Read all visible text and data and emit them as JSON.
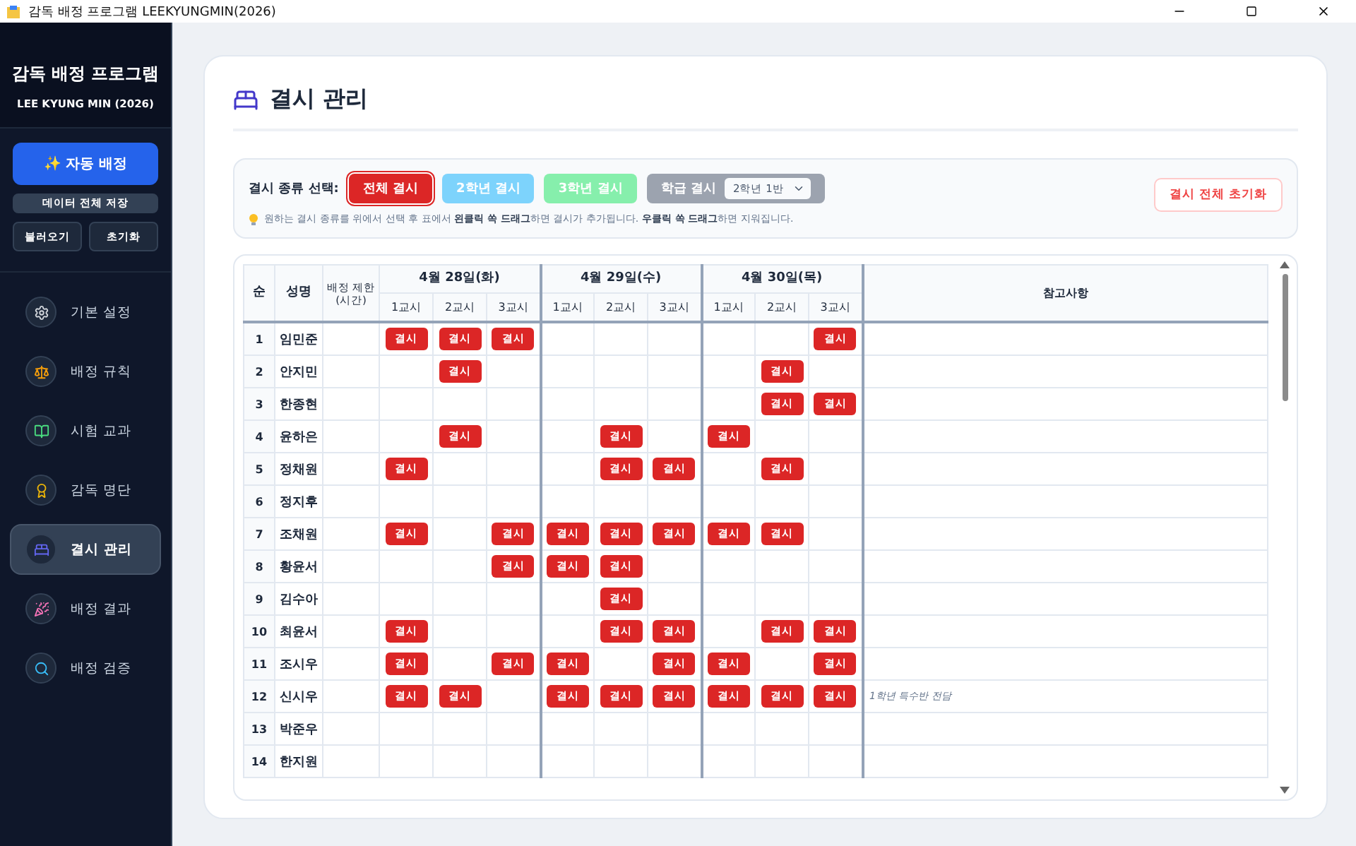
{
  "window": {
    "title": "감독 배정 프로그램 LEEKYUNGMIN(2026)"
  },
  "sidebar": {
    "title": "감독 배정 프로그램",
    "subtitle": "LEE KYUNG MIN (2026)",
    "primary_button": "✨ 자동 배정",
    "save_button": "데이터 전체 저장",
    "small_buttons": [
      "불러오기",
      "초기화"
    ],
    "items": [
      {
        "label": "기본 설정",
        "kind": "gear",
        "selected": false
      },
      {
        "label": "배정 규칙",
        "kind": "scale",
        "selected": false
      },
      {
        "label": "시험 교과",
        "kind": "books",
        "selected": false
      },
      {
        "label": "감독 명단",
        "kind": "medal",
        "selected": false
      },
      {
        "label": "결시 관리",
        "kind": "bed",
        "selected": true
      },
      {
        "label": "배정 결과",
        "kind": "party",
        "selected": false
      },
      {
        "label": "배정 검증",
        "kind": "search",
        "selected": false
      }
    ]
  },
  "page": {
    "title": "결시 관리"
  },
  "filter": {
    "label": "결시 종류 선택:",
    "types": [
      {
        "label": "전체 결시",
        "color": "#dc2626",
        "selected": true
      },
      {
        "label": "2학년 결시",
        "color": "#7dd3fc",
        "selected": false
      },
      {
        "label": "3학년 결시",
        "color": "#86efac",
        "selected": false
      },
      {
        "label": "학급 결시",
        "color": "#9ca3af",
        "selected": false,
        "select_value": "2학년 1반"
      }
    ],
    "hint": "원하는 결시 종류를 위에서 선택 후 표에서 **왼클릭 쏙 드래그**하면 결시가 추가됩니다. **우클릭 쏙 드래그**하면 지워집니다.",
    "reset_button": "결시 전체 초기화"
  },
  "table": {
    "columns": [
      "순",
      "성명",
      "배정 제한\n(시간)"
    ],
    "days": [
      {
        "label": "4월 28일(화)",
        "periods": [
          "1교시",
          "2교시",
          "3교시"
        ]
      },
      {
        "label": "4월 29일(수)",
        "periods": [
          "1교시",
          "2교시",
          "3교시"
        ]
      },
      {
        "label": "4월 30일(목)",
        "periods": [
          "1교시",
          "2교시",
          "3교시"
        ]
      }
    ],
    "notes_column": "참고사항",
    "rows": [
      {
        "no": "1",
        "name": "임민준",
        "slots": [
          {
            "absent": true,
            "label": "결시"
          },
          {
            "absent": true,
            "label": "결시"
          },
          {
            "absent": true,
            "label": "결시"
          },
          {
            "absent": false
          },
          {
            "absent": false
          },
          {
            "absent": false
          },
          {
            "absent": false
          },
          {
            "absent": false
          },
          {
            "absent": true,
            "label": "결시"
          }
        ]
      },
      {
        "no": "2",
        "name": "안지민",
        "slots": [
          {
            "absent": false
          },
          {
            "absent": true,
            "label": "결시"
          },
          {
            "absent": false
          },
          {
            "absent": false
          },
          {
            "absent": false
          },
          {
            "absent": false
          },
          {
            "absent": false
          },
          {
            "absent": true,
            "label": "결시"
          },
          {
            "absent": false
          }
        ]
      },
      {
        "no": "3",
        "name": "한종현",
        "slots": [
          {
            "absent": false
          },
          {
            "absent": false
          },
          {
            "absent": false
          },
          {
            "absent": false
          },
          {
            "absent": false
          },
          {
            "absent": false
          },
          {
            "absent": false
          },
          {
            "absent": true,
            "label": "결시"
          },
          {
            "absent": true,
            "label": "결시"
          }
        ]
      },
      {
        "no": "4",
        "name": "윤하은",
        "slots": [
          {
            "absent": false
          },
          {
            "absent": true,
            "label": "결시"
          },
          {
            "absent": false
          },
          {
            "absent": false
          },
          {
            "absent": true,
            "label": "결시"
          },
          {
            "absent": false
          },
          {
            "absent": true,
            "label": "결시"
          },
          {
            "absent": false
          },
          {
            "absent": false
          }
        ]
      },
      {
        "no": "5",
        "name": "정채원",
        "slots": [
          {
            "absent": true,
            "label": "결시"
          },
          {
            "absent": false
          },
          {
            "absent": false
          },
          {
            "absent": false
          },
          {
            "absent": true,
            "label": "결시"
          },
          {
            "absent": true,
            "label": "결시"
          },
          {
            "absent": false
          },
          {
            "absent": true,
            "label": "결시"
          },
          {
            "absent": false
          }
        ]
      },
      {
        "no": "6",
        "name": "정지후",
        "slots": [
          {
            "absent": false
          },
          {
            "absent": false
          },
          {
            "absent": false
          },
          {
            "absent": false
          },
          {
            "absent": false
          },
          {
            "absent": false
          },
          {
            "absent": false
          },
          {
            "absent": false
          },
          {
            "absent": false
          }
        ]
      },
      {
        "no": "7",
        "name": "조채원",
        "slots": [
          {
            "absent": true,
            "label": "결시"
          },
          {
            "absent": false
          },
          {
            "absent": true,
            "label": "결시"
          },
          {
            "absent": true,
            "label": "결시"
          },
          {
            "absent": true,
            "label": "결시"
          },
          {
            "absent": true,
            "label": "결시"
          },
          {
            "absent": true,
            "label": "결시"
          },
          {
            "absent": true,
            "label": "결시"
          },
          {
            "absent": false
          }
        ]
      },
      {
        "no": "8",
        "name": "황윤서",
        "slots": [
          {
            "absent": false
          },
          {
            "absent": false
          },
          {
            "absent": true,
            "label": "결시"
          },
          {
            "absent": true,
            "label": "결시"
          },
          {
            "absent": true,
            "label": "결시"
          },
          {
            "absent": false
          },
          {
            "absent": false
          },
          {
            "absent": false
          },
          {
            "absent": false
          }
        ]
      },
      {
        "no": "9",
        "name": "김수아",
        "slots": [
          {
            "absent": false
          },
          {
            "absent": false
          },
          {
            "absent": false
          },
          {
            "absent": false
          },
          {
            "absent": true,
            "label": "결시"
          },
          {
            "absent": false
          },
          {
            "absent": false
          },
          {
            "absent": false
          },
          {
            "absent": false
          }
        ]
      },
      {
        "no": "10",
        "name": "최윤서",
        "slots": [
          {
            "absent": true,
            "label": "결시"
          },
          {
            "absent": false
          },
          {
            "absent": false
          },
          {
            "absent": false
          },
          {
            "absent": true,
            "label": "결시"
          },
          {
            "absent": true,
            "label": "결시"
          },
          {
            "absent": false
          },
          {
            "absent": true,
            "label": "결시"
          },
          {
            "absent": true,
            "label": "결시"
          }
        ]
      },
      {
        "no": "11",
        "name": "조시우",
        "slots": [
          {
            "absent": true,
            "label": "결시"
          },
          {
            "absent": false
          },
          {
            "absent": true,
            "label": "결시"
          },
          {
            "absent": true,
            "label": "결시"
          },
          {
            "absent": false
          },
          {
            "absent": true,
            "label": "결시"
          },
          {
            "absent": true,
            "label": "결시"
          },
          {
            "absent": false
          },
          {
            "absent": true,
            "label": "결시"
          }
        ]
      },
      {
        "no": "12",
        "name": "신시우",
        "slots": [
          {
            "absent": true,
            "label": "결시"
          },
          {
            "absent": true,
            "label": "결시"
          },
          {
            "absent": false
          },
          {
            "absent": true,
            "label": "결시"
          },
          {
            "absent": true,
            "label": "결시"
          },
          {
            "absent": true,
            "label": "결시"
          },
          {
            "absent": true,
            "label": "결시"
          },
          {
            "absent": true,
            "label": "결시"
          },
          {
            "absent": true,
            "label": "결시"
          }
        ],
        "note": "1학년 특수반 전담"
      },
      {
        "no": "13",
        "name": "박준우",
        "slots": [
          {
            "absent": false
          },
          {
            "absent": false
          },
          {
            "absent": false
          },
          {
            "absent": false
          },
          {
            "absent": false
          },
          {
            "absent": false
          },
          {
            "absent": false
          },
          {
            "absent": false
          },
          {
            "absent": false
          }
        ]
      },
      {
        "no": "14",
        "name": "한지원",
        "slots": [
          {
            "absent": false
          },
          {
            "absent": false
          },
          {
            "absent": false
          },
          {
            "absent": false
          },
          {
            "absent": false
          },
          {
            "absent": false
          },
          {
            "absent": false
          },
          {
            "absent": false
          },
          {
            "absent": false
          }
        ]
      }
    ]
  }
}
